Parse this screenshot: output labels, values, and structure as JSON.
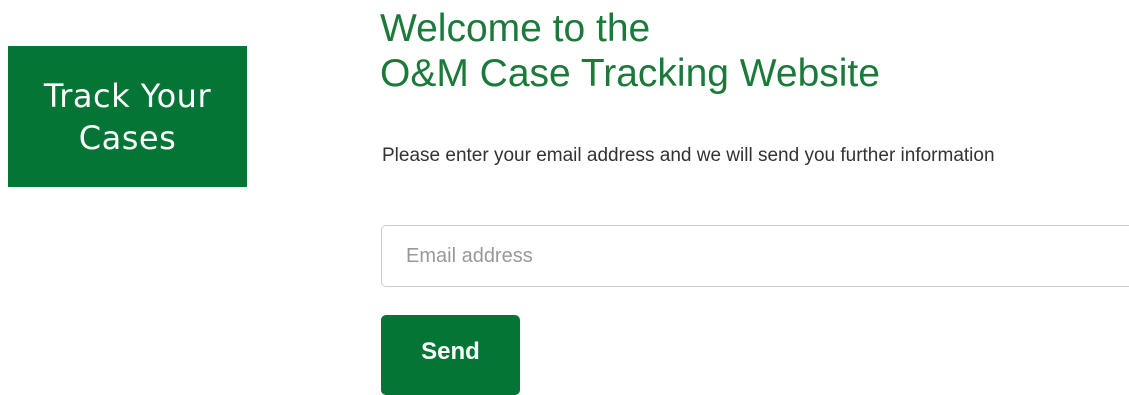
{
  "badge": {
    "line1": "Track Your",
    "line2": "Cases",
    "background": "#047535"
  },
  "header": {
    "title_line1": "Welcome to the",
    "title_line2": "O&M Case Tracking Website",
    "title_color": "#1b7a3a"
  },
  "form": {
    "instructions": "Please enter your email address and we will send you further information",
    "email": {
      "value": "",
      "placeholder": "Email address"
    },
    "send_label": "Send",
    "button_color": "#047535"
  }
}
